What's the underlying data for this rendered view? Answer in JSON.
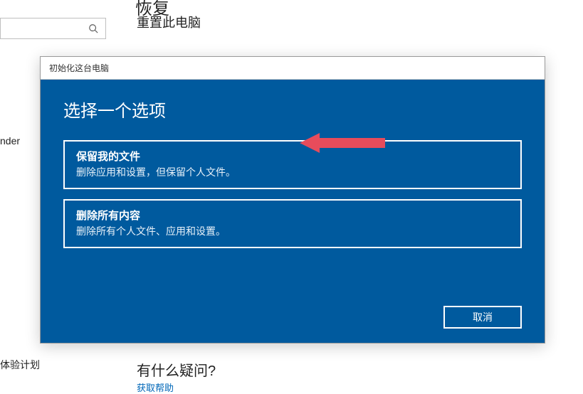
{
  "background": {
    "title_partial": "恢复",
    "reset_heading": "重置此电脑",
    "side_text_1": "nder",
    "side_text_2": "体验计划",
    "question_heading": "有什么疑问?",
    "help_link": "获取帮助"
  },
  "search": {
    "placeholder": ""
  },
  "dialog": {
    "titlebar": "初始化这台电脑",
    "heading": "选择一个选项",
    "options": [
      {
        "title": "保留我的文件",
        "desc": "删除应用和设置，但保留个人文件。"
      },
      {
        "title": "删除所有内容",
        "desc": "删除所有个人文件、应用和设置。"
      }
    ],
    "cancel_label": "取消"
  },
  "annotation": {
    "arrow_color": "#e74c5b"
  }
}
